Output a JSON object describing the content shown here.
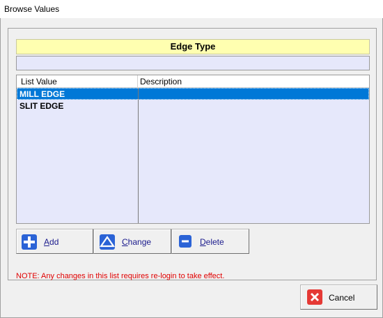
{
  "window": {
    "title": "Browse Values"
  },
  "header": {
    "title": "Edge Type"
  },
  "filter": {
    "value": ""
  },
  "list": {
    "columns": [
      "List Value",
      "Description"
    ],
    "rows": [
      {
        "value": "MILL EDGE",
        "description": "",
        "selected": true
      },
      {
        "value": "SLIT EDGE",
        "description": "",
        "selected": false
      }
    ]
  },
  "buttons": {
    "add": {
      "mnemonic": "A",
      "rest": "dd",
      "icon": "plus-icon"
    },
    "change": {
      "mnemonic": "C",
      "rest": "hange",
      "icon": "triangle-up-icon"
    },
    "delete": {
      "mnemonic": "D",
      "rest": "elete",
      "icon": "minus-icon"
    },
    "cancel": {
      "label": "Cancel",
      "icon": "close-x-icon"
    }
  },
  "note": "NOTE: Any changes in this list requires re-login to take effect.",
  "colors": {
    "header_bg": "#ffffb0",
    "list_bg": "#e6e8fb",
    "selection": "#0078d7",
    "note": "#e00000",
    "cancel_icon": "#e53935",
    "action_icon": "#2b63d6"
  }
}
